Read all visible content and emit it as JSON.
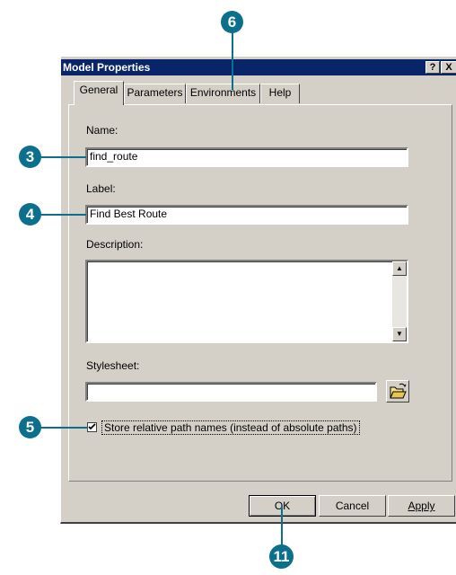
{
  "window": {
    "title": "Model Properties",
    "help_button": "?",
    "close_button": "X"
  },
  "tabs": [
    {
      "label": "General"
    },
    {
      "label": "Parameters"
    },
    {
      "label": "Environments"
    },
    {
      "label": "Help"
    }
  ],
  "form": {
    "name_label": "Name:",
    "name_value": "find_route",
    "label_label": "Label:",
    "label_value": "Find Best Route",
    "description_label": "Description:",
    "description_value": "",
    "stylesheet_label": "Stylesheet:",
    "stylesheet_value": "",
    "relative_paths_label": "Store relative path names (instead of absolute paths)",
    "relative_paths_checked": true
  },
  "buttons": {
    "ok": "OK",
    "cancel": "Cancel",
    "apply": "Apply"
  },
  "callouts": {
    "environments": "6",
    "name": "3",
    "label": "4",
    "checkbox": "5",
    "ok": "11"
  },
  "colors": {
    "titlebar": "#0a246a",
    "callout": "#0c6f8c",
    "dialog": "#d4d0c8"
  },
  "icons": {
    "browse": "open-folder-icon",
    "scroll_up": "scroll-up-arrow-icon",
    "scroll_down": "scroll-down-arrow-icon",
    "check": "checkmark-icon"
  }
}
